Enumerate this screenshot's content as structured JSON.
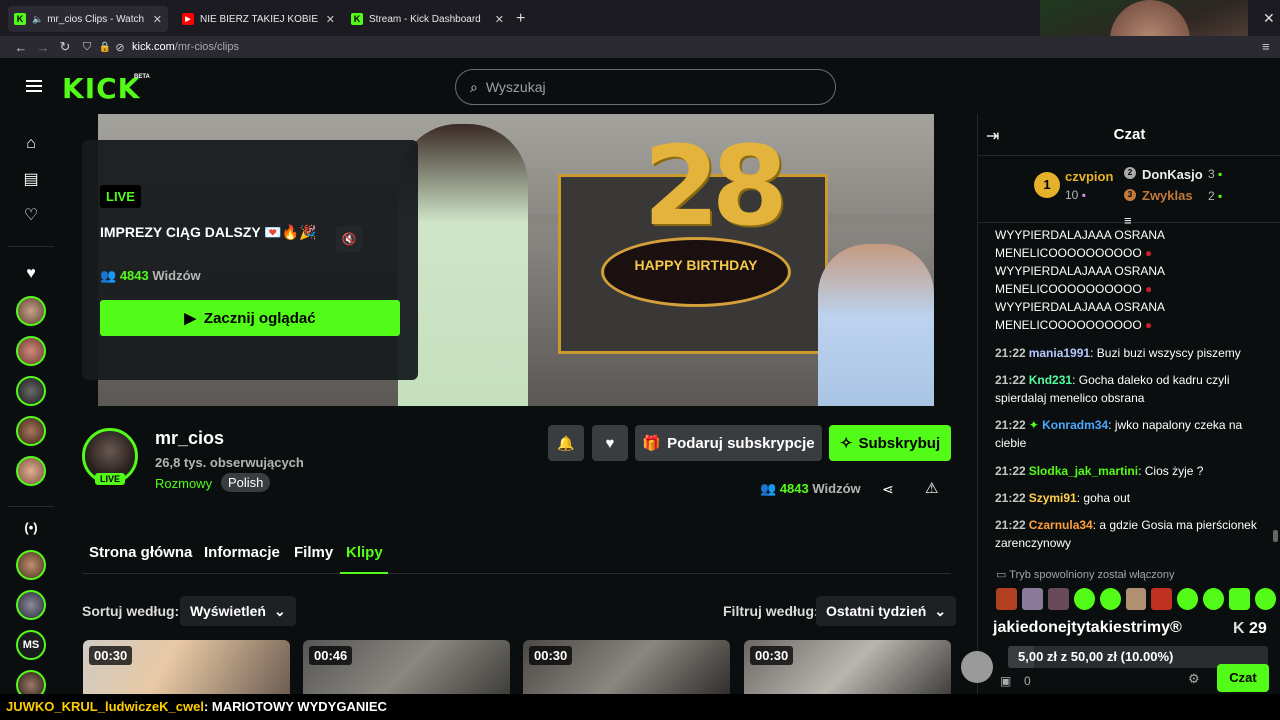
{
  "browser": {
    "tabs": [
      {
        "title": "mr_cios Clips - Watch Live on Kick",
        "favicon": "kick-favicon"
      },
      {
        "title": "NIE BIERZ TAKIEJ KOBIETY - YouTube",
        "favicon": "youtube-favicon"
      },
      {
        "title": "Stream - Kick Dashboard",
        "favicon": "kick-favicon"
      }
    ],
    "url_domain": "kick.com",
    "url_path": "/mr-cios/clips"
  },
  "header": {
    "logo": "KICK",
    "logo_badge": "BETA",
    "search_placeholder": "Wyszukaj"
  },
  "stream_card": {
    "live_badge": "LIVE",
    "title": "IMPREZY CIĄG DALSZY 💌🔥🎉",
    "viewers_count": "4843",
    "viewers_label": "Widzów",
    "watch_button": "Zacznij oglądać"
  },
  "video_overlay": {
    "balloons": "28",
    "banner": "HAPPY BIRTHDAY"
  },
  "channel": {
    "name": "mr_cios",
    "followers": "26,8 tys. obserwujących",
    "category": "Rozmowy",
    "language": "Polish",
    "live_badge": "LIVE",
    "gift_button": "Podaruj subskrypcje",
    "subscribe_button": "Subskrybuj",
    "viewers_count": "4843",
    "viewers_label": "Widzów"
  },
  "tabs": [
    "Strona główna",
    "Informacje",
    "Filmy",
    "Klipy"
  ],
  "active_tab": "Klipy",
  "filters": {
    "sort_label": "Sortuj według:",
    "sort_value": "Wyświetleń",
    "filter_label": "Filtruj według:",
    "filter_value": "Ostatni tydzień"
  },
  "clips": [
    {
      "duration": "00:30"
    },
    {
      "duration": "00:46"
    },
    {
      "duration": "00:30"
    },
    {
      "duration": "00:30"
    }
  ],
  "chat": {
    "title": "Czat",
    "leaderboard": [
      {
        "rank": "1",
        "name": "czvpion",
        "count": "10"
      },
      {
        "rank": "2",
        "name": "DonKasjo",
        "count": "3"
      },
      {
        "rank": "3",
        "name": "Zwyklas",
        "count": "2"
      }
    ],
    "spam_lines": [
      "WYYPIERDALAJAAA OSRANA",
      "MENELICOOOOOOOOOO",
      "WYYPIERDALAJAAA OSRANA",
      "MENELICOOOOOOOOOO",
      "WYYPIERDALAJAAA OSRANA",
      "MENELICOOOOOOOOOO"
    ],
    "messages": [
      {
        "time": "21:22",
        "user": "mania1991",
        "color": "#b5c9ff",
        "text": "Buzi buzi wszyscy piszemy"
      },
      {
        "time": "21:22",
        "user": "Knd231",
        "color": "#53fc9c",
        "text": "Gocha daleko od kadru czyli spierdalaj menelico obsrana"
      },
      {
        "time": "21:22",
        "user": "Konradm34",
        "color": "#4aa8ff",
        "text": "jwko napalony czeka na ciebie"
      },
      {
        "time": "21:22",
        "user": "Slodka_jak_martini",
        "color": "#53fc18",
        "text": "Cios żyje ?"
      },
      {
        "time": "21:22",
        "user": "Szymi91",
        "color": "#ffd24a",
        "text": "goha out"
      },
      {
        "time": "21:22",
        "user": "Czarnula34",
        "color": "#ff9f3a",
        "text": "a gdzie Gosia ma pierścionek zarenczynowy"
      }
    ],
    "slow_mode_notice": "Tryb spowolniony został włączony",
    "goal_title": "jakiedonejtytakiestrimy®",
    "goal_count": "29",
    "goal_progress": "5,00 zł z 50,00 zł (10.00%)",
    "goal_fraction": 0.1,
    "input_counter": "0",
    "send_button": "Czat"
  },
  "bottom_ticker": {
    "user": "JUWKO_KRUL_ludwiczeK_cwel",
    "text": ": MARIOTOWY WYDYGANIEC"
  },
  "colors": {
    "accent": "#53fc18",
    "background": "#0b0e0f"
  }
}
